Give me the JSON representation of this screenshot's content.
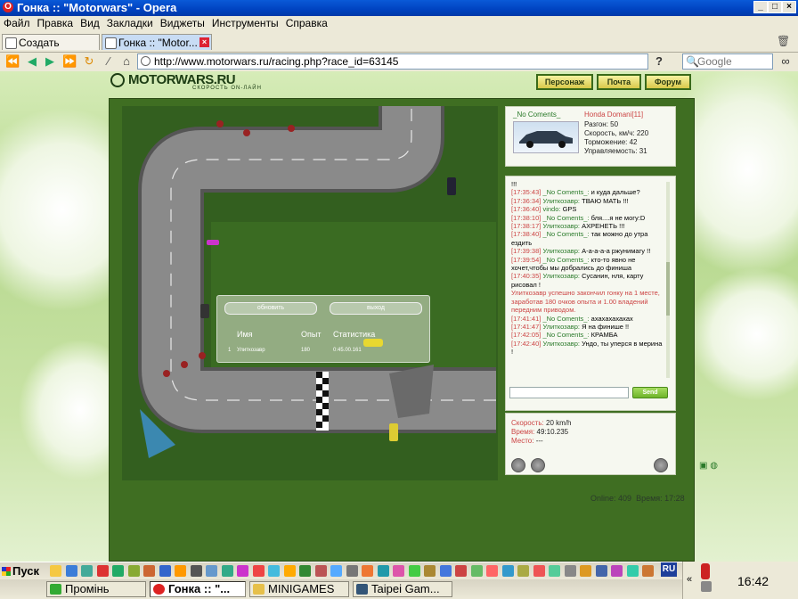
{
  "window": {
    "title": "Гонка :: \"Motorwars\" - Opera"
  },
  "menu": [
    "Файл",
    "Правка",
    "Вид",
    "Закладки",
    "Виджеты",
    "Инструменты",
    "Справка"
  ],
  "tabs": [
    {
      "label": "Создать вкладку"
    },
    {
      "label": "Гонка :: \"Motor..."
    }
  ],
  "address": {
    "url": "http://www.motorwars.ru/racing.php?race_id=63145",
    "search_placeholder": "Google"
  },
  "site": {
    "logo": "MOTORWARS.RU",
    "slogan": "СКОРОСТЬ ON-ЛАЙН",
    "nav": [
      "Персонаж",
      "Почта",
      "Форум"
    ]
  },
  "results": {
    "refresh_button": "обновить",
    "exit_button": "выход",
    "headers": {
      "name": "Имя",
      "exp": "Опыт",
      "stats": "Статистика"
    },
    "row": {
      "place": "1",
      "name": "Улиткозавр",
      "exp": "180",
      "time": "0:45.00.161"
    }
  },
  "car_info": {
    "user": "_No Coments_",
    "model": "Honda Domani[11]",
    "stats": [
      "Разгон: 50",
      "Скорость, км/ч: 220",
      "Торможение: 42",
      "Управляемость: 31"
    ]
  },
  "chat": {
    "messages": [
      {
        "ts": "",
        "nick": "",
        "text": "!!!"
      },
      {
        "ts": "[17:35:43]",
        "nick": "_No Coments_:",
        "text": "и куда дальше?"
      },
      {
        "ts": "[17:36:34]",
        "nick": "Улиткозавр:",
        "text": "ТВАЮ МАТЬ !!!"
      },
      {
        "ts": "[17:36:40]",
        "nick": "vindo:",
        "text": "GPS"
      },
      {
        "ts": "[17:38:10]",
        "nick": "_No Coments_:",
        "text": "бля....я не могу:D"
      },
      {
        "ts": "[17:38:17]",
        "nick": "Улиткозавр:",
        "text": "АХРЕНЕТЬ !!!"
      },
      {
        "ts": "[17:38:40]",
        "nick": "_No Coments_:",
        "text": "так можно до утра ездить"
      },
      {
        "ts": "[17:39:38]",
        "nick": "Улиткозавр:",
        "text": "А-а-а-а-а ржунимагу !!"
      },
      {
        "ts": "[17:39:54]",
        "nick": "_No Coments_:",
        "text": "кто-то явно не хочет,чтобы мы добрались до финиша"
      },
      {
        "ts": "[17:40:35]",
        "nick": "Улиткозавр:",
        "text": "Сусанин, нля, карту рисовал !"
      },
      {
        "ts": "",
        "nick": "",
        "text": "Улиткозавр успешно закончил гонку на 1 месте, заработав 180 очков опыта и 1.00 владений передним приводом.",
        "system": true
      },
      {
        "ts": "[17:41:41]",
        "nick": "_No Coments_:",
        "text": "ахахахахахах"
      },
      {
        "ts": "[17:41:47]",
        "nick": "Улиткозавр:",
        "text": "Я на финише !!"
      },
      {
        "ts": "[17:42:05]",
        "nick": "_No Coments_:",
        "text": "КРАМБА"
      },
      {
        "ts": "[17:42:40]",
        "nick": "Улиткозавр:",
        "text": "Ундо, ты уперся в мерина !"
      }
    ],
    "send_label": "Send"
  },
  "race_status": {
    "speed_label": "Скорость:",
    "speed_value": "20 km/h",
    "time_label": "Время:",
    "time_value": "49:10.235",
    "place_label": "Место:",
    "place_value": "---"
  },
  "footer": {
    "online": "Online: 409",
    "time": "Время: 17:28"
  },
  "taskbar": {
    "start": "Пуск",
    "tasks": [
      "Промінь",
      "Гонка :: \"...",
      "MINIGAMES",
      "Taipei  Gam..."
    ],
    "lang": "RU",
    "clock": "16:42"
  },
  "colors": {
    "titlebar": "#0042c0",
    "accent_green": "#2a7a2a",
    "chat_time": "#c44444",
    "game_bg": "#3f6e22"
  }
}
